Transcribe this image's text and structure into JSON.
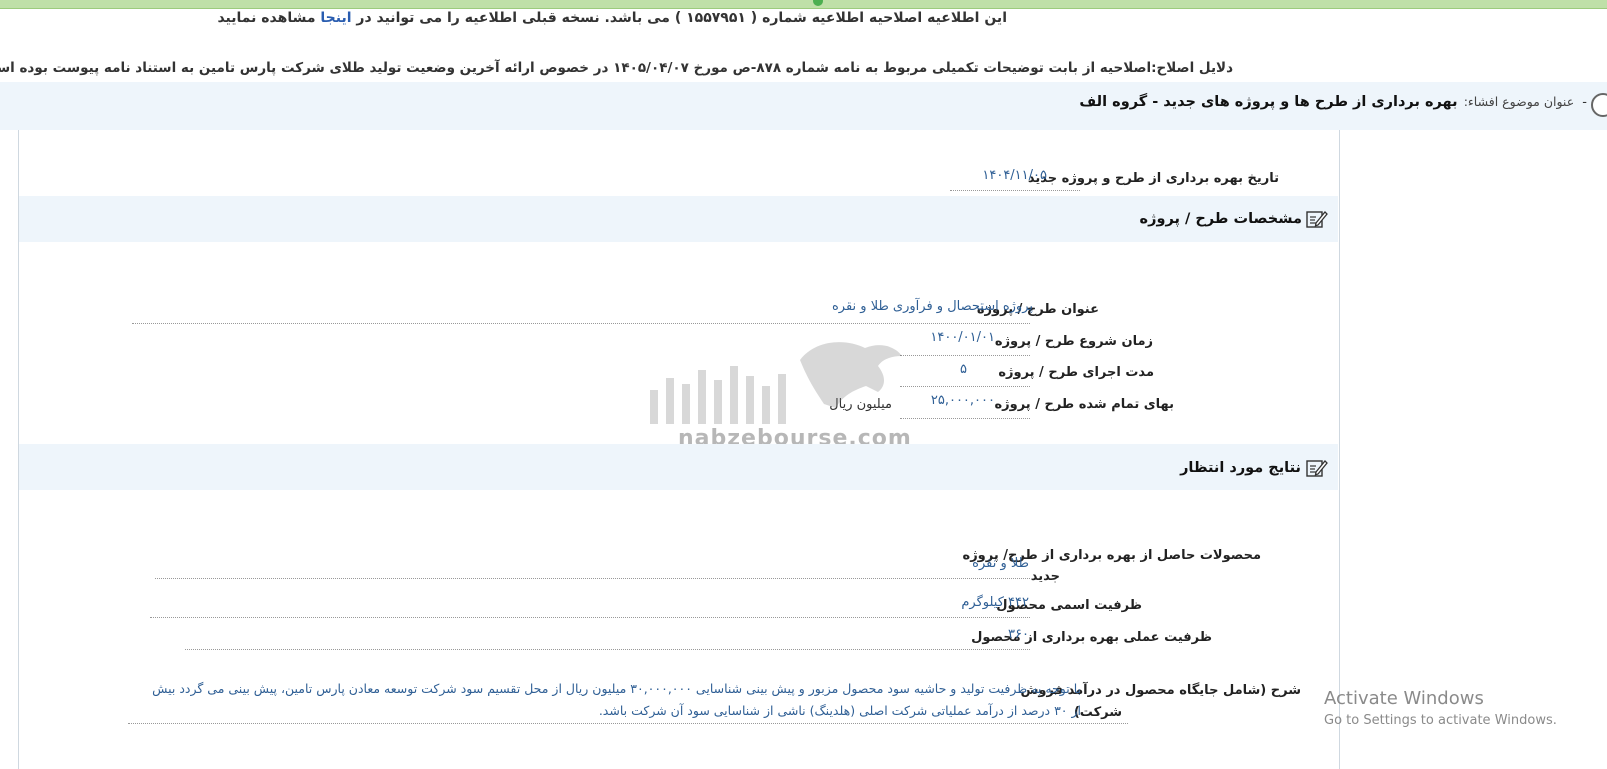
{
  "notice": {
    "prefix": "این اطلاعیه اصلاحیه اطلاعیه شماره ( ۱۵۵۷۹۵۱ ) می باشد. نسخه قبلی اطلاعیه را می توانید در ",
    "link": "اینجا",
    "suffix": " مشاهده نمایید"
  },
  "reason": "دلایل اصلاح:اصلاحیه از بابت توضیحات تکمیلی مربوط به نامه شماره ۸۷۸-ص مورخ ۱۴۰۵/۰۴/۰۷ در خصوص ارائه آخرین وضعیت تولید طلای شرکت پارس تامین به استناد نامه پیوست بوده است",
  "subject": {
    "bullet": "-",
    "label": "عنوان موضوع افشاء:",
    "value": "بهره برداری از طرح ها و پروژه های جدید - گروه الف"
  },
  "launch_date": {
    "label": "تاریخ بهره برداری از طرح و پروژه جدید",
    "value": "۱۴۰۴/۱۱/۰۵"
  },
  "project_section": {
    "title": "مشخصات طرح / پروژه",
    "fields": {
      "title": {
        "label": "عنوان طرح / پروژه",
        "value": "پروژه استحصال و فرآوری طلا و نقره"
      },
      "start": {
        "label": "زمان شروع طرح / پروژه",
        "value": "۱۴۰۰/۰۱/۰۱"
      },
      "duration": {
        "label": "مدت اجرای طرح / پروژه",
        "value": "۵"
      },
      "cost": {
        "label": "بهای تمام شده طرح / پروژه",
        "value": "۲۵,۰۰۰,۰۰۰",
        "unit": "میلیون ریال"
      }
    }
  },
  "results_section": {
    "title": "نتایج مورد انتظار",
    "fields": {
      "products": {
        "label_line1": "محصولات حاصل از بهره برداری از طرح/ پروژه",
        "label_line2": "جدید",
        "value": "طلا و نقره"
      },
      "nominal_capacity": {
        "label": "ظرفیت اسمی محصول",
        "value": "۴۴۲ کیلوگرم"
      },
      "actual_capacity": {
        "label": "ظرفیت عملی بهره برداری از محصول",
        "value": "۳۶۰"
      }
    },
    "description": {
      "label_line1": "شرح (شامل جایگاه محصول در درآمد فروش",
      "label_line2": "شرکت)",
      "text": "با توجه به ظرفیت تولید و حاشیه سود محصول مزبور و پیش بینی شناسایی ۳۰,۰۰۰,۰۰۰ میلیون ریال از محل تقسیم سود شرکت توسعه معادن پارس تامین، پیش بینی می گردد بیش از ۳۰ درصد از درآمد عملیاتی شرکت اصلی (هلدینگ) ناشی از شناسایی سود آن شرکت باشد."
    }
  },
  "watermark": {
    "logo_text": "نبض بورس",
    "domain": "nabzebourse.com"
  },
  "windows_activation": {
    "line1": "Activate Windows",
    "line2": "Go to Settings to activate Windows."
  }
}
